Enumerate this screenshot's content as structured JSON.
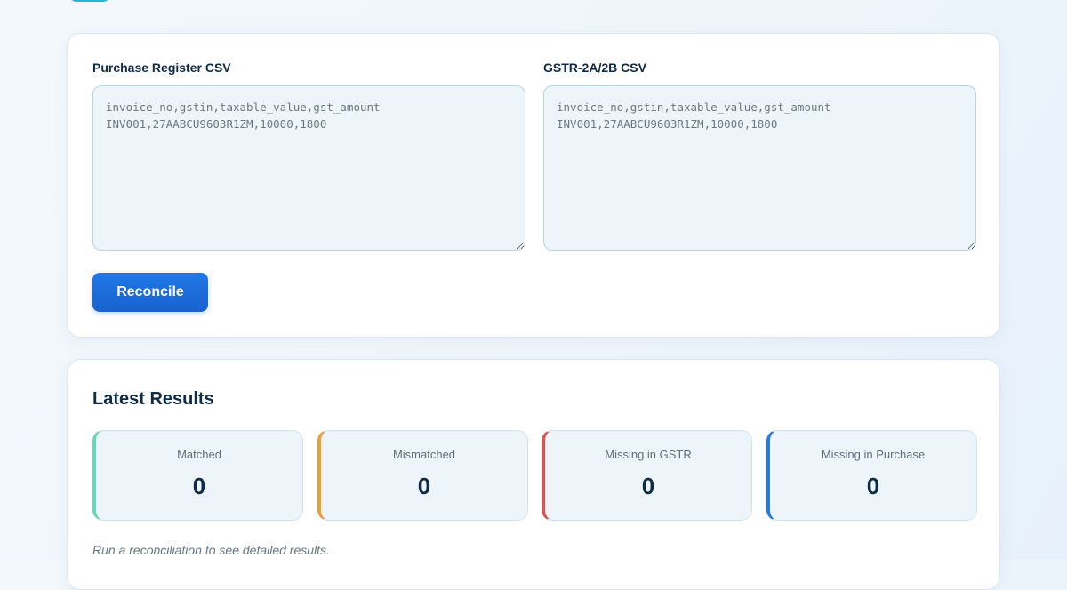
{
  "inputs": {
    "purchase": {
      "label": "Purchase Register CSV",
      "placeholder": "invoice_no,gstin,taxable_value,gst_amount\nINV001,27AABCU9603R1ZM,10000,1800"
    },
    "gstr": {
      "label": "GSTR-2A/2B CSV",
      "placeholder": "invoice_no,gstin,taxable_value,gst_amount\nINV001,27AABCU9603R1ZM,10000,1800"
    },
    "reconcile_label": "Reconcile"
  },
  "results": {
    "title": "Latest Results",
    "stats": [
      {
        "label": "Matched",
        "value": "0",
        "accent": "#6dd6b7"
      },
      {
        "label": "Mismatched",
        "value": "0",
        "accent": "#ec9f33"
      },
      {
        "label": "Missing in GSTR",
        "value": "0",
        "accent": "#d95454"
      },
      {
        "label": "Missing in Purchase",
        "value": "0",
        "accent": "#2a7ad9"
      }
    ],
    "hint": "Run a reconciliation to see detailed results."
  },
  "colors": {
    "primary": "#1f6fe0",
    "text": "#0f2a44"
  }
}
